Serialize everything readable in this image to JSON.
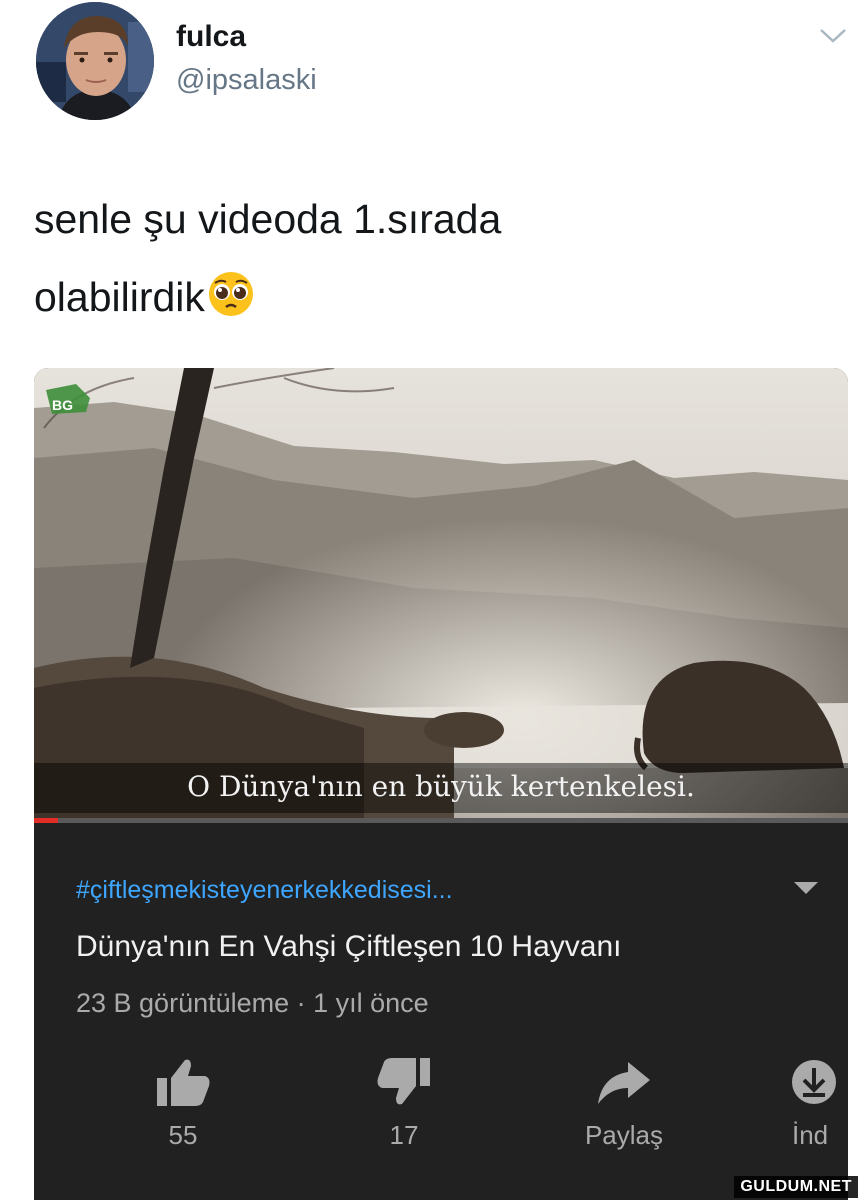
{
  "tweet": {
    "display_name": "fulca",
    "handle": "@ipsalaski",
    "text_line1": "senle şu videoda 1.sırada",
    "text_line2": "olabilirdik",
    "emoji": "pleading-face-emoji"
  },
  "video": {
    "channel_badge": "BG",
    "subtitle": "O Dünya'nın en büyük kertenkelesi.",
    "progress_fraction": 0.03,
    "hashtag": "#çiftleşmekisteyenerkekkedisesi...",
    "title": "Dünya'nın En Vahşi Çiftleşen 10 Hayvanı",
    "meta": "23 B görüntüleme · 1 yıl önce",
    "actions": {
      "like_count": "55",
      "dislike_count": "17",
      "share_label": "Paylaş",
      "download_label": "İnd"
    }
  },
  "watermark": "GULDUM.NET",
  "colors": {
    "hashtag": "#3ea6ff",
    "card_background": "#212121",
    "progress": "#e52d27"
  }
}
